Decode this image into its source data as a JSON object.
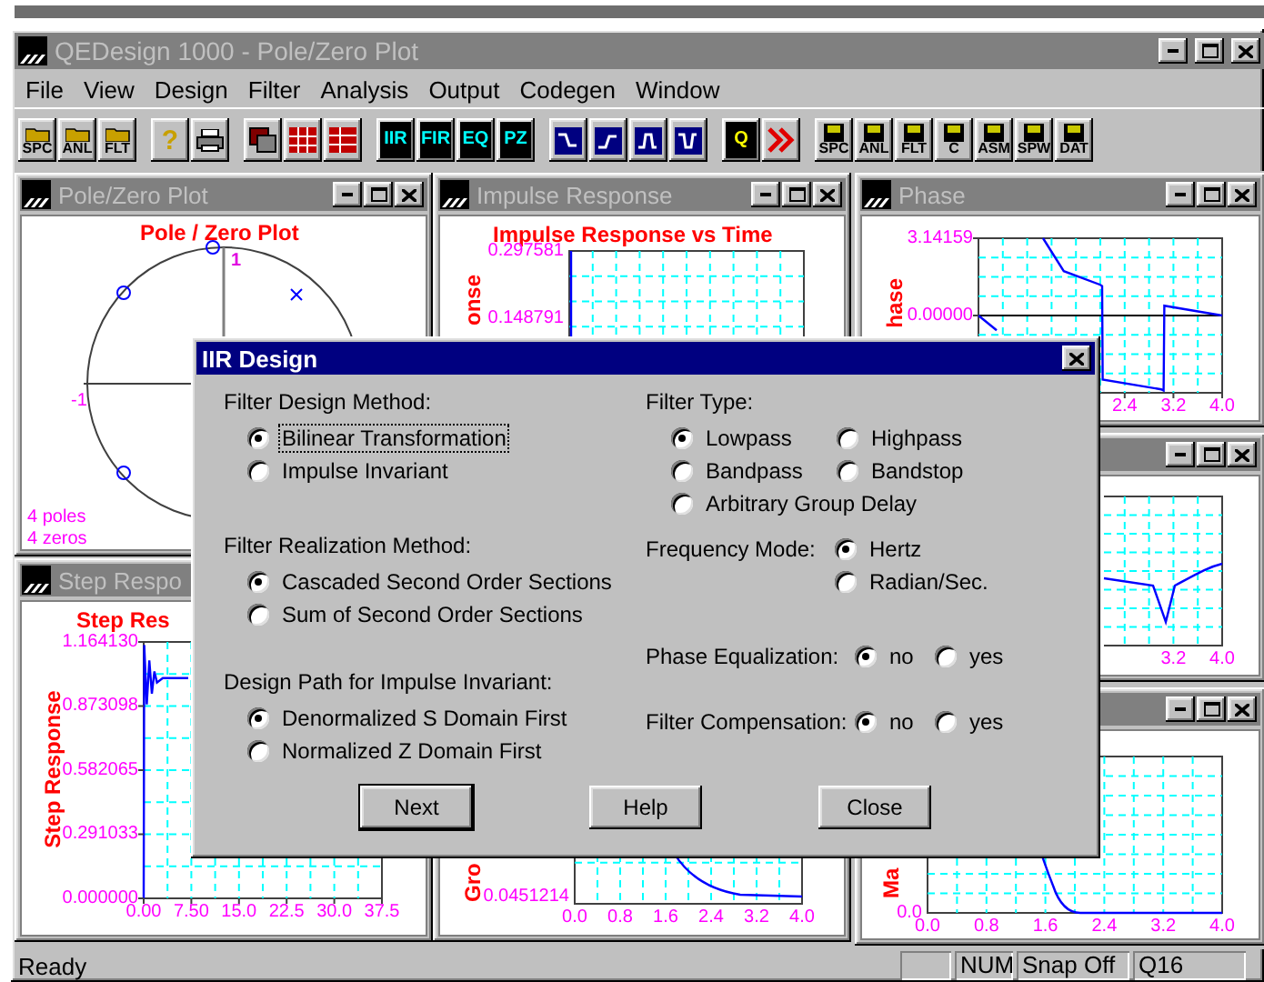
{
  "main_window": {
    "title": "QEDesign 1000 - Pole/Zero Plot"
  },
  "menu": [
    "File",
    "View",
    "Design",
    "Filter",
    "Analysis",
    "Output",
    "Codegen",
    "Window"
  ],
  "toolbar": [
    [
      {
        "kind": "open",
        "label": "SPC"
      },
      {
        "kind": "open",
        "label": "ANL"
      },
      {
        "kind": "open",
        "label": "FLT"
      }
    ],
    [
      {
        "kind": "help",
        "label": "?"
      },
      {
        "kind": "print"
      }
    ],
    [
      {
        "kind": "cascade"
      },
      {
        "kind": "tile"
      },
      {
        "kind": "arrange"
      }
    ],
    [
      {
        "kind": "mode",
        "label": "IIR"
      },
      {
        "kind": "mode",
        "label": "FIR"
      },
      {
        "kind": "mode",
        "label": "EQ"
      },
      {
        "kind": "mode",
        "label": "PZ"
      }
    ],
    [
      {
        "kind": "lowpass"
      },
      {
        "kind": "highpass"
      },
      {
        "kind": "bandpass"
      },
      {
        "kind": "bandstop"
      }
    ],
    [
      {
        "kind": "quantize",
        "label": "Q"
      },
      {
        "kind": "next"
      }
    ],
    [
      {
        "kind": "save",
        "label": "SPC"
      },
      {
        "kind": "save",
        "label": "ANL"
      },
      {
        "kind": "save",
        "label": "FLT"
      },
      {
        "kind": "save",
        "label": "C"
      },
      {
        "kind": "save",
        "label": "ASM"
      },
      {
        "kind": "save",
        "label": "SPW"
      },
      {
        "kind": "save",
        "label": "DAT"
      }
    ]
  ],
  "windows": [
    {
      "title": "Pole/Zero Plot",
      "kind": "polezero",
      "plot": {
        "title": "Pole / Zero Plot",
        "axis_labels": [
          "-1",
          "1"
        ],
        "summary": [
          "4 poles",
          "4 zeros"
        ]
      }
    },
    {
      "title": "Impulse Response",
      "kind": "plot",
      "plot": {
        "title": "Impulse Response vs Time",
        "ylabel": "onse",
        "yticks": [
          "0.297581",
          "0.148791"
        ]
      }
    },
    {
      "title": "Phase",
      "kind": "chart",
      "chart_data": {
        "type": "line",
        "ylabel": "hase",
        "grid": true,
        "x": [
          0,
          0.3,
          0.5,
          1.05,
          1.06,
          1.4,
          2.0,
          2.03,
          2.04,
          3.0,
          3.04,
          3.05,
          4.0
        ],
        "series": [
          {
            "color": "#0000ff",
            "values": [
              0,
              -0.6,
              null,
              null,
              3.14,
              1.8,
              1.25,
              1.2,
              -2.6,
              -3.0,
              -3.05,
              0.4,
              0.0
            ]
          }
        ],
        "xlim": [
          0,
          4
        ],
        "ylim": [
          -3.14159,
          3.14159
        ],
        "xticks": [
          2.4,
          3.2,
          {
            "value": 4,
            "label": "4.0"
          }
        ],
        "yticks": [
          {
            "value": 3.14159,
            "label": "3.14159"
          },
          {
            "value": 0,
            "label": "0.00000"
          }
        ],
        "ref_lines": [
          {
            "axis": "y",
            "value": 0
          }
        ]
      }
    },
    {
      "kind": "plot",
      "plot": {
        "xticks": [
          "3.2",
          "4.0"
        ]
      }
    },
    {
      "title": "Step Respo",
      "kind": "chart",
      "chart_data": {
        "type": "line",
        "title": "Step Res",
        "ylabel": "Step Response",
        "grid": true,
        "x": [
          0,
          0.1,
          0.5,
          0.9,
          1.3,
          1.7,
          2.1,
          3,
          7
        ],
        "series": [
          {
            "color": "#0000ff",
            "values": [
              0,
              1.15,
              0.88,
              1.08,
              0.93,
              1.03,
              0.98,
              1.0,
              1.0
            ]
          }
        ],
        "xlim": [
          0,
          37.5
        ],
        "ylim": [
          0,
          1.16413
        ],
        "xticks": [
          {
            "value": 0,
            "label": "0.00"
          },
          {
            "value": 7.5,
            "label": "7.50"
          },
          {
            "value": 15,
            "label": "15.0"
          },
          {
            "value": 22.5,
            "label": "22.5"
          },
          {
            "value": 30,
            "label": "30.0"
          },
          {
            "value": 37.5,
            "label": "37.5"
          }
        ],
        "yticks": [
          {
            "value": 1.16413,
            "label": "1.164130"
          },
          {
            "value": 0.873098,
            "label": "0.873098"
          },
          {
            "value": 0.582065,
            "label": "0.582065"
          },
          {
            "value": 0.291033,
            "label": "0.291033"
          },
          {
            "value": 0,
            "label": "0.000000"
          }
        ]
      }
    },
    {
      "kind": "plot",
      "plot": {
        "ylabel": "Gro",
        "yticks": [
          "0.0451214"
        ],
        "xticks": [
          "0.0",
          "0.8",
          "1.6",
          "2.4",
          "3.2",
          "4.0"
        ]
      }
    },
    {
      "kind": "plot",
      "plot": {
        "ylabel": "Ma",
        "yticks": [
          "0.0"
        ],
        "xticks": [
          "0.0",
          "0.8",
          "1.6",
          "2.4",
          "3.2",
          "4.0"
        ]
      }
    }
  ],
  "dialog": {
    "title": "IIR Design",
    "left_groups": [
      {
        "label": "Filter Design Method:",
        "options": [
          {
            "label": "Bilinear Transformation",
            "selected": true,
            "focused": true
          },
          {
            "label": "Impulse Invariant",
            "selected": false,
            "focused": false
          }
        ]
      },
      {
        "label": "Filter Realization Method:",
        "options": [
          {
            "label": "Cascaded Second Order Sections",
            "selected": true,
            "focused": false
          },
          {
            "label": "Sum of Second Order Sections",
            "selected": false,
            "focused": false
          }
        ]
      },
      {
        "label": "Design Path for Impulse Invariant:",
        "options": [
          {
            "label": "Denormalized S Domain First",
            "selected": true,
            "focused": false
          },
          {
            "label": "Normalized Z Domain First",
            "selected": false,
            "focused": false
          }
        ]
      }
    ],
    "filter_type": {
      "label": "Filter Type:",
      "options": [
        {
          "label": "Lowpass",
          "selected": true
        },
        {
          "label": "Highpass",
          "selected": false
        },
        {
          "label": "Bandpass",
          "selected": false
        },
        {
          "label": "Bandstop",
          "selected": false
        },
        {
          "label": "Arbitrary Group Delay",
          "selected": false
        }
      ]
    },
    "settings": [
      {
        "label": "Frequency Mode:",
        "kind": "stacked",
        "options": [
          {
            "label": "Hertz",
            "selected": true
          },
          {
            "label": "Radian/Sec.",
            "selected": false
          }
        ]
      },
      {
        "label": "Phase Equalization:",
        "kind": "inline",
        "options": [
          {
            "label": "no",
            "selected": true
          },
          {
            "label": "yes",
            "selected": false
          }
        ]
      },
      {
        "label": "Filter Compensation:",
        "kind": "inline",
        "options": [
          {
            "label": "no",
            "selected": true
          },
          {
            "label": "yes",
            "selected": false
          }
        ]
      }
    ],
    "buttons": [
      {
        "label": "Next",
        "default": true
      },
      {
        "label": "Help",
        "default": false
      },
      {
        "label": "Close",
        "default": false
      }
    ]
  },
  "status_bar": {
    "message": "Ready",
    "panes": [
      "NUM",
      "Snap Off",
      "Q16"
    ]
  }
}
